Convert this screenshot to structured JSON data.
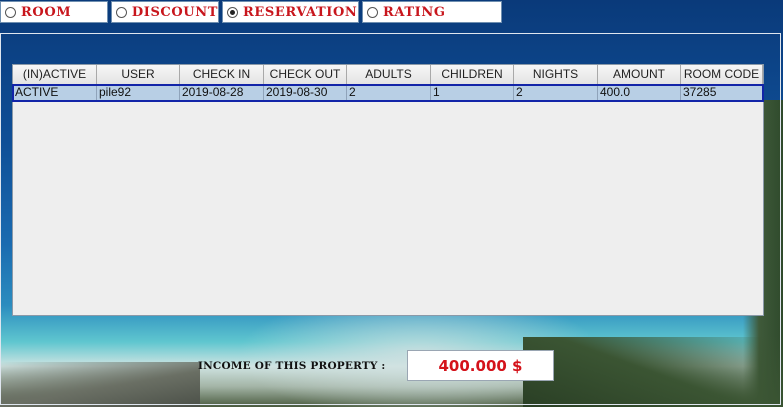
{
  "tabs": [
    {
      "label": "ROOM",
      "selected": false
    },
    {
      "label": "DISCOUNT",
      "selected": false
    },
    {
      "label": "RESERVATION",
      "selected": true
    },
    {
      "label": "RATING",
      "selected": false
    }
  ],
  "table": {
    "columns": [
      "(IN)ACTIVE",
      "USER",
      "CHECK IN",
      "CHECK OUT",
      "ADULTS",
      "CHILDREN",
      "NIGHTS",
      "AMOUNT",
      "ROOM CODE"
    ],
    "rows": [
      [
        "ACTIVE",
        "pile92",
        "2019-08-28",
        "2019-08-30",
        "2",
        "1",
        "2",
        "400.0",
        "37285"
      ]
    ]
  },
  "income": {
    "label": "INCOME OF THIS PROPERTY :",
    "value": "400.000 $"
  },
  "colors": {
    "accent_text": "#c8161d",
    "income_value": "#d4121a",
    "selection_fill": "#b8cfe5",
    "selection_border": "#1224a8"
  }
}
